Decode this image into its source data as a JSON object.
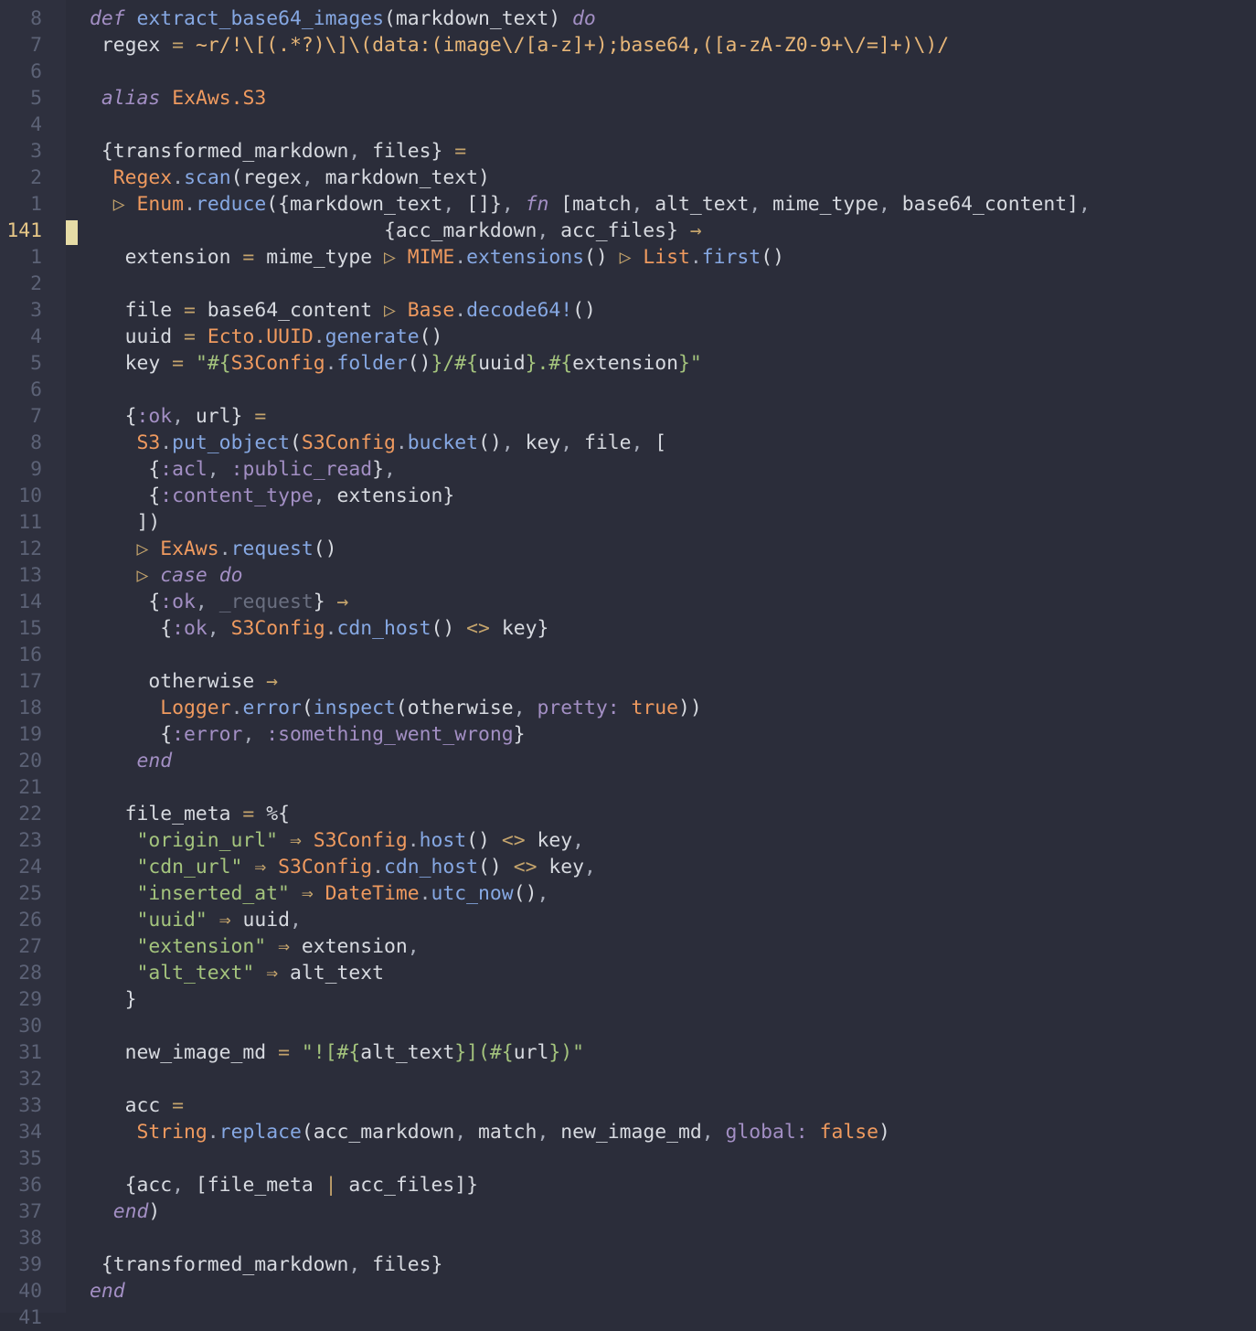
{
  "editor": {
    "cursor_line": "141",
    "gutter": [
      "8",
      "7",
      "6",
      "5",
      "4",
      "3",
      "2",
      "1",
      "141",
      "1",
      "2",
      "3",
      "4",
      "5",
      "6",
      "7",
      "8",
      "9",
      "10",
      "11",
      "12",
      "13",
      "14",
      "15",
      "16",
      "17",
      "18",
      "19",
      "20",
      "21",
      "22",
      "23",
      "24",
      "25",
      "26",
      "27",
      "28",
      "29",
      "30",
      "31",
      "32",
      "33",
      "34",
      "35",
      "36",
      "37",
      "38",
      "39",
      "40",
      "41"
    ],
    "lines": [
      [
        [
          "k",
          "def"
        ],
        [
          "",
          "  "
        ],
        [
          "f",
          "extract_base64_images"
        ],
        [
          "",
          "(markdown_text) "
        ],
        [
          "k",
          "do"
        ]
      ],
      [
        [
          "",
          "  regex "
        ],
        [
          "o",
          "="
        ],
        [
          "",
          "  "
        ],
        [
          "re",
          "~r/!\\[(.*?)\\]\\(data:(image\\/[a-z]+);base64,([a-zA-Z0-9+\\/=]+)\\)/"
        ]
      ],
      [],
      [
        [
          "",
          "  "
        ],
        [
          "k",
          "alias"
        ],
        [
          "",
          "  "
        ],
        [
          "m",
          "ExAws.S3"
        ]
      ],
      [],
      [
        [
          "",
          "  {transformed_markdown"
        ],
        [
          "p",
          ","
        ],
        [
          "",
          "  files} "
        ],
        [
          "o",
          "="
        ]
      ],
      [
        [
          "",
          "    "
        ],
        [
          "m",
          "Regex"
        ],
        [
          "p",
          "."
        ],
        [
          "f",
          "scan"
        ],
        [
          "",
          "(regex"
        ],
        [
          "p",
          ","
        ],
        [
          "",
          "  markdown_text)"
        ]
      ],
      [
        [
          "",
          "    "
        ],
        [
          "o",
          "▷"
        ],
        [
          "",
          "  "
        ],
        [
          "m",
          "Enum"
        ],
        [
          "p",
          "."
        ],
        [
          "f",
          "reduce"
        ],
        [
          "",
          "({markdown_text"
        ],
        [
          "p",
          ","
        ],
        [
          "",
          "  []}"
        ],
        [
          "p",
          ","
        ],
        [
          "",
          "  "
        ],
        [
          "k",
          "fn"
        ],
        [
          "",
          "  [match"
        ],
        [
          "p",
          ","
        ],
        [
          "",
          "  alt_text"
        ],
        [
          "p",
          ","
        ],
        [
          "",
          "  mime_type"
        ],
        [
          "p",
          ","
        ],
        [
          "",
          "  base64_content]"
        ],
        [
          "p",
          ","
        ]
      ],
      [
        [
          "",
          "                                                  {acc_markdown"
        ],
        [
          "p",
          ","
        ],
        [
          "",
          "  acc_files} "
        ],
        [
          "o",
          "→"
        ]
      ],
      [
        [
          "",
          "      extension "
        ],
        [
          "o",
          "="
        ],
        [
          "",
          "  mime_type "
        ],
        [
          "o",
          "▷"
        ],
        [
          "",
          "  "
        ],
        [
          "m",
          "MIME"
        ],
        [
          "p",
          "."
        ],
        [
          "f",
          "extensions"
        ],
        [
          "",
          "() "
        ],
        [
          "o",
          "▷"
        ],
        [
          "",
          "  "
        ],
        [
          "m",
          "List"
        ],
        [
          "p",
          "."
        ],
        [
          "f",
          "first"
        ],
        [
          "",
          "()"
        ]
      ],
      [],
      [
        [
          "",
          "      file "
        ],
        [
          "o",
          "="
        ],
        [
          "",
          "  base64_content "
        ],
        [
          "o",
          "▷"
        ],
        [
          "",
          "  "
        ],
        [
          "m",
          "Base"
        ],
        [
          "p",
          "."
        ],
        [
          "f",
          "decode64!"
        ],
        [
          "",
          "()"
        ]
      ],
      [
        [
          "",
          "      uuid "
        ],
        [
          "o",
          "="
        ],
        [
          "",
          "  "
        ],
        [
          "m",
          "Ecto.UUID"
        ],
        [
          "p",
          "."
        ],
        [
          "f",
          "generate"
        ],
        [
          "",
          "()"
        ]
      ],
      [
        [
          "",
          "      key "
        ],
        [
          "o",
          "="
        ],
        [
          "",
          "  "
        ],
        [
          "s",
          "\"#{"
        ],
        [
          "m",
          "S3Config"
        ],
        [
          "p",
          "."
        ],
        [
          "f",
          "folder"
        ],
        [
          "",
          "()"
        ],
        [
          "s",
          "}/#{"
        ],
        [
          "",
          "uuid"
        ],
        [
          "s",
          "}.#{"
        ],
        [
          "",
          "extension"
        ],
        [
          "s",
          "}\""
        ]
      ],
      [],
      [
        [
          "",
          "      {"
        ],
        [
          "a",
          ":ok"
        ],
        [
          "p",
          ","
        ],
        [
          "",
          "  url} "
        ],
        [
          "o",
          "="
        ]
      ],
      [
        [
          "",
          "        "
        ],
        [
          "m",
          "S3"
        ],
        [
          "p",
          "."
        ],
        [
          "f",
          "put_object"
        ],
        [
          "",
          "("
        ],
        [
          "m",
          "S3Config"
        ],
        [
          "p",
          "."
        ],
        [
          "f",
          "bucket"
        ],
        [
          "",
          "()"
        ],
        [
          "p",
          ","
        ],
        [
          "",
          "  key"
        ],
        [
          "p",
          ","
        ],
        [
          "",
          "  file"
        ],
        [
          "p",
          ","
        ],
        [
          "",
          "  ["
        ]
      ],
      [
        [
          "",
          "          {"
        ],
        [
          "a",
          ":acl"
        ],
        [
          "p",
          ","
        ],
        [
          "",
          "  "
        ],
        [
          "a",
          ":public_read"
        ],
        [
          "",
          "}"
        ],
        [
          "p",
          ","
        ]
      ],
      [
        [
          "",
          "          {"
        ],
        [
          "a",
          ":content_type"
        ],
        [
          "p",
          ","
        ],
        [
          "",
          "  extension}"
        ]
      ],
      [
        [
          "",
          "        ])"
        ]
      ],
      [
        [
          "",
          "        "
        ],
        [
          "o",
          "▷"
        ],
        [
          "",
          "  "
        ],
        [
          "m",
          "ExAws"
        ],
        [
          "p",
          "."
        ],
        [
          "f",
          "request"
        ],
        [
          "",
          "()"
        ]
      ],
      [
        [
          "",
          "        "
        ],
        [
          "o",
          "▷"
        ],
        [
          "",
          "  "
        ],
        [
          "k",
          "case"
        ],
        [
          "",
          "  "
        ],
        [
          "k",
          "do"
        ]
      ],
      [
        [
          "",
          "          {"
        ],
        [
          "a",
          ":ok"
        ],
        [
          "p",
          ","
        ],
        [
          "",
          "  "
        ],
        [
          "c",
          "_request"
        ],
        [
          "",
          "} "
        ],
        [
          "o",
          "→"
        ]
      ],
      [
        [
          "",
          "            {"
        ],
        [
          "a",
          ":ok"
        ],
        [
          "p",
          ","
        ],
        [
          "",
          "  "
        ],
        [
          "m",
          "S3Config"
        ],
        [
          "p",
          "."
        ],
        [
          "f",
          "cdn_host"
        ],
        [
          "",
          "() "
        ],
        [
          "o",
          "<>"
        ],
        [
          "",
          "  key}"
        ]
      ],
      [],
      [
        [
          "",
          "          otherwise "
        ],
        [
          "o",
          "→"
        ]
      ],
      [
        [
          "",
          "            "
        ],
        [
          "m",
          "Logger"
        ],
        [
          "p",
          "."
        ],
        [
          "f",
          "error"
        ],
        [
          "",
          "("
        ],
        [
          "f",
          "inspect"
        ],
        [
          "",
          "(otherwise"
        ],
        [
          "p",
          ","
        ],
        [
          "",
          "  "
        ],
        [
          "a",
          "pretty:"
        ],
        [
          "",
          "  "
        ],
        [
          "b",
          "true"
        ],
        [
          "",
          "))"
        ]
      ],
      [
        [
          "",
          "            {"
        ],
        [
          "a",
          ":error"
        ],
        [
          "p",
          ","
        ],
        [
          "",
          "  "
        ],
        [
          "a",
          ":something_went_wrong"
        ],
        [
          "",
          "}"
        ]
      ],
      [
        [
          "",
          "        "
        ],
        [
          "k",
          "end"
        ]
      ],
      [],
      [
        [
          "",
          "      file_meta "
        ],
        [
          "o",
          "="
        ],
        [
          "",
          "  %{"
        ]
      ],
      [
        [
          "",
          "        "
        ],
        [
          "s",
          "\"origin_url\""
        ],
        [
          "",
          "  "
        ],
        [
          "o",
          "⇒"
        ],
        [
          "",
          "  "
        ],
        [
          "m",
          "S3Config"
        ],
        [
          "p",
          "."
        ],
        [
          "f",
          "host"
        ],
        [
          "",
          "() "
        ],
        [
          "o",
          "<>"
        ],
        [
          "",
          "  key"
        ],
        [
          "p",
          ","
        ]
      ],
      [
        [
          "",
          "        "
        ],
        [
          "s",
          "\"cdn_url\""
        ],
        [
          "",
          "  "
        ],
        [
          "o",
          "⇒"
        ],
        [
          "",
          "  "
        ],
        [
          "m",
          "S3Config"
        ],
        [
          "p",
          "."
        ],
        [
          "f",
          "cdn_host"
        ],
        [
          "",
          "() "
        ],
        [
          "o",
          "<>"
        ],
        [
          "",
          "  key"
        ],
        [
          "p",
          ","
        ]
      ],
      [
        [
          "",
          "        "
        ],
        [
          "s",
          "\"inserted_at\""
        ],
        [
          "",
          "  "
        ],
        [
          "o",
          "⇒"
        ],
        [
          "",
          "  "
        ],
        [
          "m",
          "DateTime"
        ],
        [
          "p",
          "."
        ],
        [
          "f",
          "utc_now"
        ],
        [
          "",
          "()"
        ],
        [
          "p",
          ","
        ]
      ],
      [
        [
          "",
          "        "
        ],
        [
          "s",
          "\"uuid\""
        ],
        [
          "",
          "  "
        ],
        [
          "o",
          "⇒"
        ],
        [
          "",
          "  uuid"
        ],
        [
          "p",
          ","
        ]
      ],
      [
        [
          "",
          "        "
        ],
        [
          "s",
          "\"extension\""
        ],
        [
          "",
          "  "
        ],
        [
          "o",
          "⇒"
        ],
        [
          "",
          "  extension"
        ],
        [
          "p",
          ","
        ]
      ],
      [
        [
          "",
          "        "
        ],
        [
          "s",
          "\"alt_text\""
        ],
        [
          "",
          "  "
        ],
        [
          "o",
          "⇒"
        ],
        [
          "",
          "  alt_text"
        ]
      ],
      [
        [
          "",
          "      }"
        ]
      ],
      [],
      [
        [
          "",
          "      new_image_md "
        ],
        [
          "o",
          "="
        ],
        [
          "",
          "  "
        ],
        [
          "s",
          "\"![#{"
        ],
        [
          "",
          "alt_text"
        ],
        [
          "s",
          "}](#{"
        ],
        [
          "",
          "url"
        ],
        [
          "s",
          "})\""
        ]
      ],
      [],
      [
        [
          "",
          "      acc "
        ],
        [
          "o",
          "="
        ]
      ],
      [
        [
          "",
          "        "
        ],
        [
          "m",
          "String"
        ],
        [
          "p",
          "."
        ],
        [
          "f",
          "replace"
        ],
        [
          "",
          "(acc_markdown"
        ],
        [
          "p",
          ","
        ],
        [
          "",
          "  match"
        ],
        [
          "p",
          ","
        ],
        [
          "",
          "  new_image_md"
        ],
        [
          "p",
          ","
        ],
        [
          "",
          "  "
        ],
        [
          "a",
          "global:"
        ],
        [
          "",
          "  "
        ],
        [
          "b",
          "false"
        ],
        [
          "",
          ")"
        ]
      ],
      [],
      [
        [
          "",
          "      {acc"
        ],
        [
          "p",
          ","
        ],
        [
          "",
          "  [file_meta "
        ],
        [
          "o",
          "|"
        ],
        [
          "",
          "  acc_files]}"
        ]
      ],
      [
        [
          "",
          "    "
        ],
        [
          "k",
          "end"
        ],
        [
          "",
          ")"
        ]
      ],
      [],
      [
        [
          "",
          "  {transformed_markdown"
        ],
        [
          "p",
          ","
        ],
        [
          "",
          "  files}"
        ]
      ],
      [
        [
          "k",
          "end"
        ]
      ],
      []
    ]
  }
}
